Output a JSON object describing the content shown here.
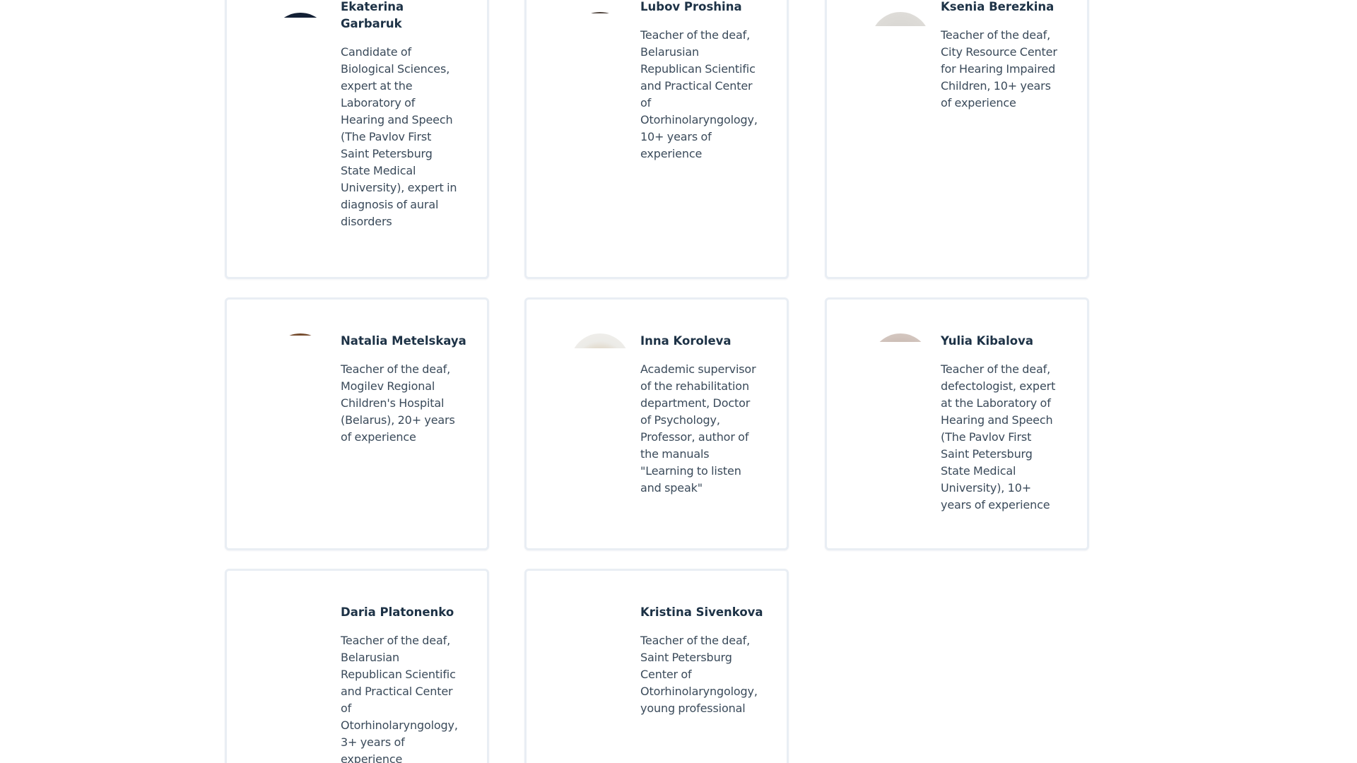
{
  "colors": {
    "card_border": "#e9eef4",
    "name_text": "#1d3246",
    "description_text": "#3a4a5a",
    "scrollbar_thumb": "#a8a8a8",
    "avatar_dark_hair": "#15233a",
    "avatar_grey": "#d6d6d4"
  },
  "experts": [
    {
      "name": "Ekaterina Garbaruk",
      "description": "Candidate of Biological Sciences, expert at the Laboratory of Hearing and Speech (The Pavlov First Saint Petersburg State Medical University), expert in diagnosis of aural disorders",
      "photo": "expert-photo"
    },
    {
      "name": "Lubov Proshina",
      "description": "Teacher of the deaf, Belarusian Republican Scientific and Practical Center of Otorhinolaryngology, 10+ years of experience",
      "photo": "expert-photo"
    },
    {
      "name": "Ksenia Berezkina",
      "description": "Teacher of the deaf, City Resource Center for Hearing Impaired Children, 10+ years of experience",
      "photo": "expert-photo"
    },
    {
      "name": "Natalia Metelskaya",
      "description": "Teacher of the deaf, Mogilev Regional Children's Hospital (Belarus), 20+ years of experience",
      "photo": "expert-photo"
    },
    {
      "name": "Inna Koroleva",
      "description": "Academic supervisor of the rehabilitation department, Doctor of Psychology, Professor, author of the manuals \"Learning to listen and speak\"",
      "photo": "expert-photo"
    },
    {
      "name": "Yulia Kibalova",
      "description": "Teacher of the deaf, defectologist, expert at the Laboratory of Hearing and Speech (The Pavlov First Saint Petersburg State Medical University), 10+ years of experience",
      "photo": "expert-photo"
    },
    {
      "name": "Daria Platonenko",
      "description": "Teacher of the deaf, Belarusian Republican Scientific and Practical Center of Otorhinolaryngology, 3+ years of experience",
      "photo": "expert-photo"
    },
    {
      "name": "Kristina Sivenkova",
      "description": "Teacher of the deaf, Saint Petersburg Center of Otorhinolaryngology, young professional",
      "photo": "expert-photo"
    }
  ]
}
